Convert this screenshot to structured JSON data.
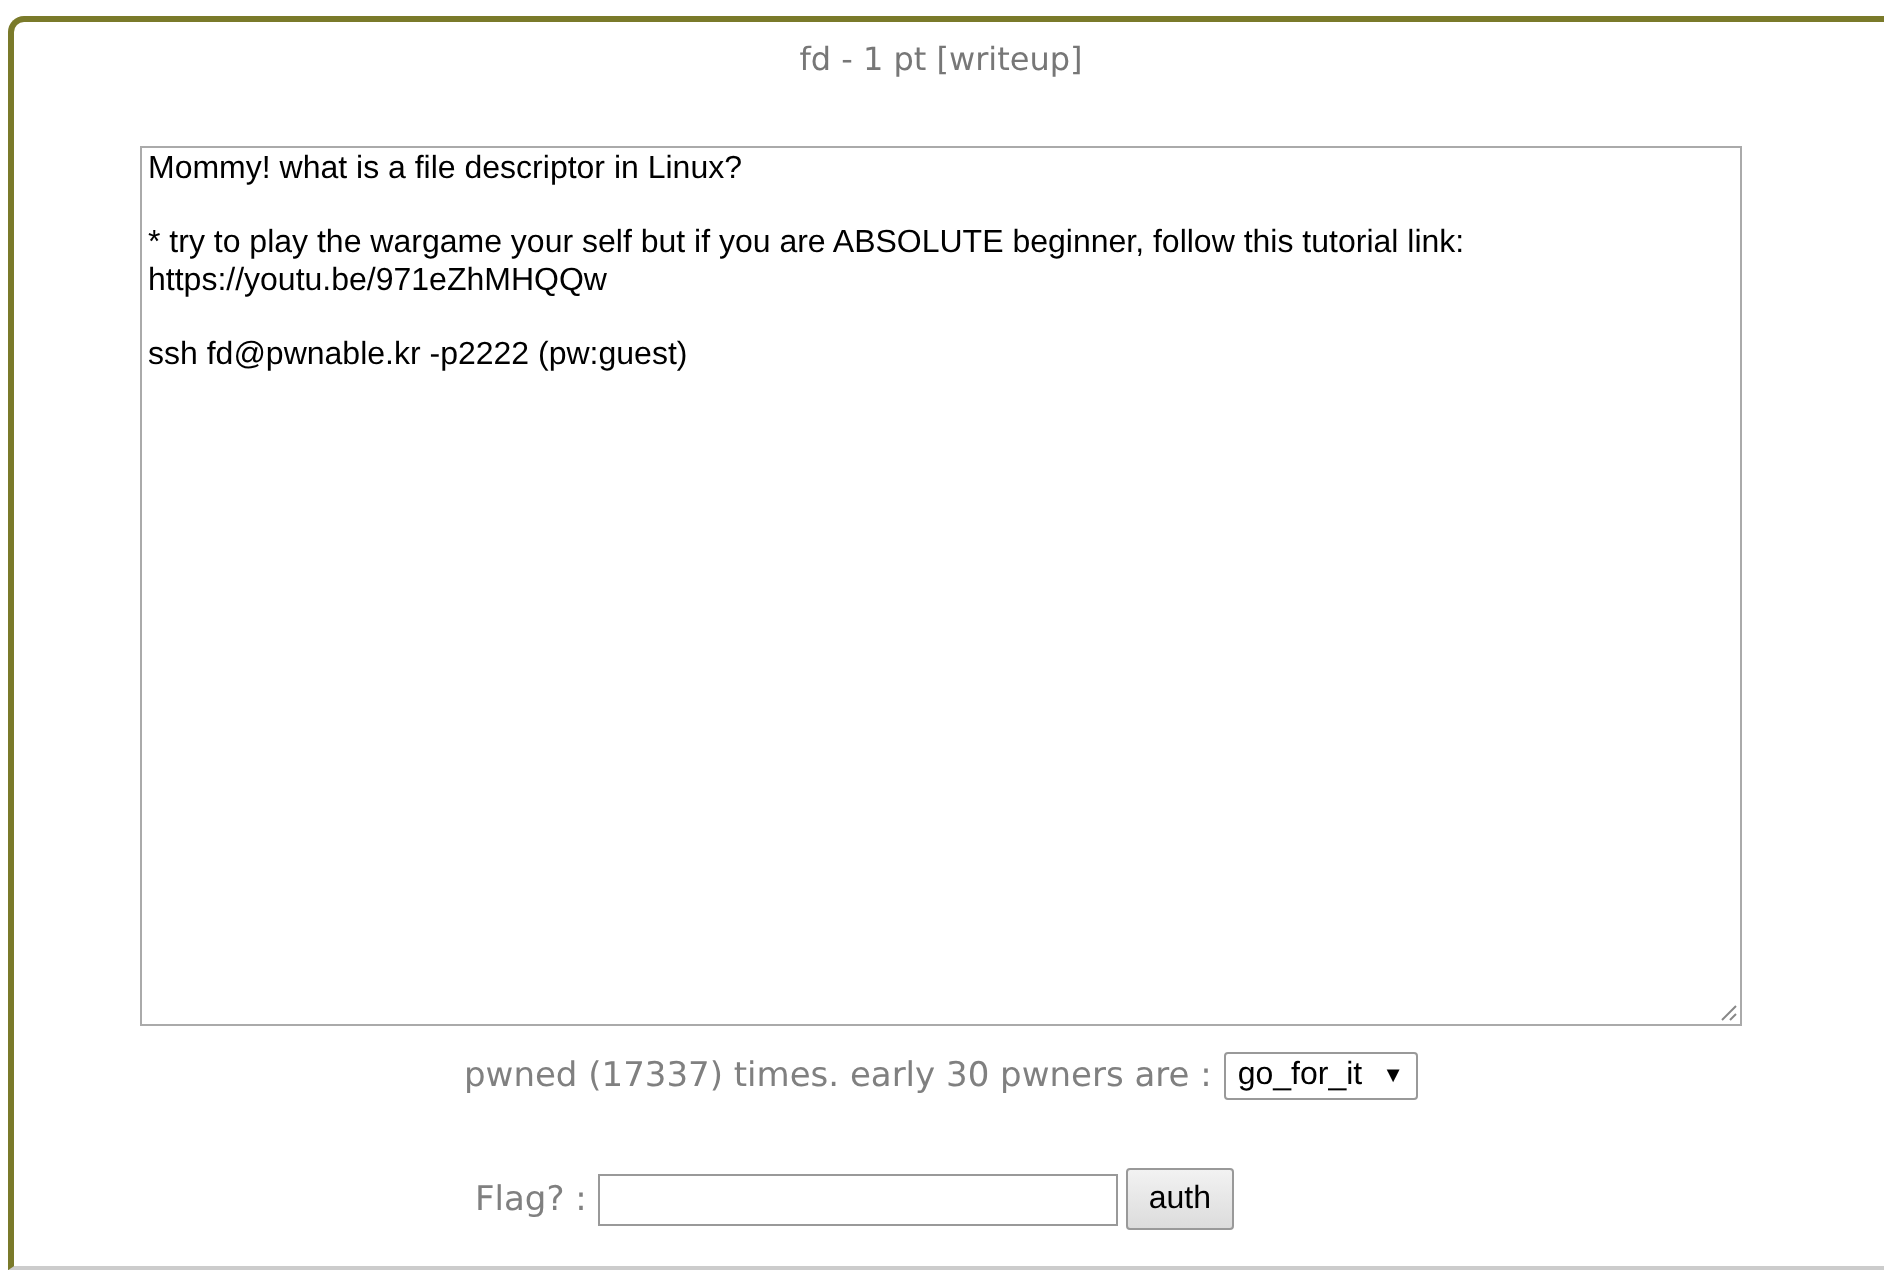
{
  "title": "fd - 1 pt [writeup]",
  "description": "Mommy! what is a file descriptor in Linux?\n\n* try to play the wargame your self but if you are ABSOLUTE beginner, follow this tutorial link:\nhttps://youtu.be/971eZhMHQQw\n\nssh fd@pwnable.kr -p2222 (pw:guest)",
  "pwned_text": "pwned (17337) times. early 30 pwners are :",
  "pwners_select": {
    "value": "go_for_it"
  },
  "select_arrow": "▼",
  "flag": {
    "label": "Flag? :",
    "button": "auth"
  }
}
